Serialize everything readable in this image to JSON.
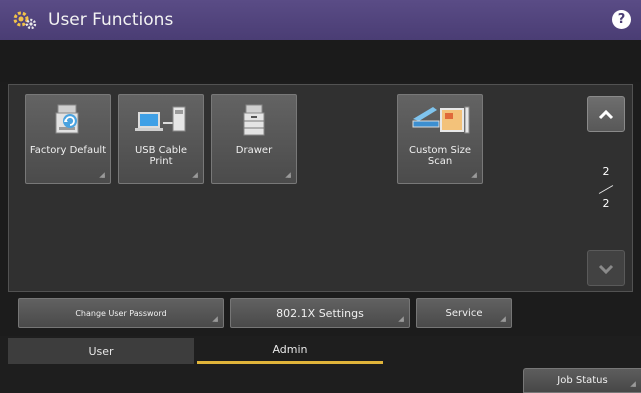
{
  "header": {
    "title": "User Functions",
    "help_label": "?"
  },
  "functions": [
    {
      "label": "Factory Default",
      "icon": "factory-default-icon"
    },
    {
      "label": "USB Cable\nPrint",
      "icon": "usb-cable-print-icon"
    },
    {
      "label": "Drawer",
      "icon": "drawer-icon"
    },
    {
      "label": "Custom Size\nScan",
      "icon": "custom-size-scan-icon"
    }
  ],
  "pagination": {
    "current": "2",
    "total": "2",
    "up_icon": "chevron-up-icon",
    "down_icon": "chevron-down-icon"
  },
  "admin_buttons": {
    "change_password": "Change User Password",
    "settings_8021x": "802.1X Settings",
    "service": "Service"
  },
  "tabs": {
    "user": "User",
    "admin": "Admin",
    "active": "admin"
  },
  "footer": {
    "job_status": "Job Status"
  },
  "colors": {
    "title_bar": "#4a3d74",
    "active_tab_underline": "#e0b43a"
  }
}
